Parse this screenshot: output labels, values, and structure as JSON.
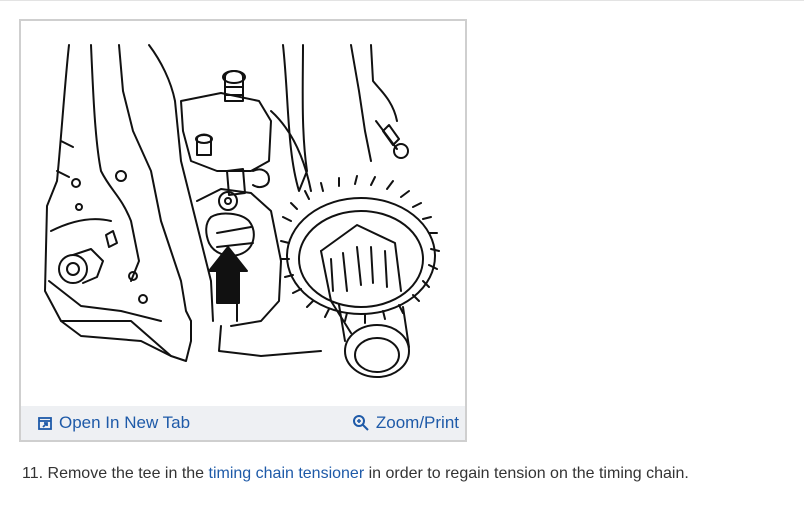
{
  "figure": {
    "image_alt": "Timing chain tensioner illustration",
    "toolbar": {
      "open_tab_label": "Open In New Tab",
      "zoom_print_label": "Zoom/Print",
      "open_tab_icon": "open-in-new-tab-icon",
      "zoom_icon": "zoom-icon",
      "link_color": "#1e5aa8"
    }
  },
  "step": {
    "number": "11.",
    "text_before": "Remove the tee in the",
    "link_text": "timing chain tensioner",
    "text_after": "in order to regain tension on the timing chain."
  }
}
